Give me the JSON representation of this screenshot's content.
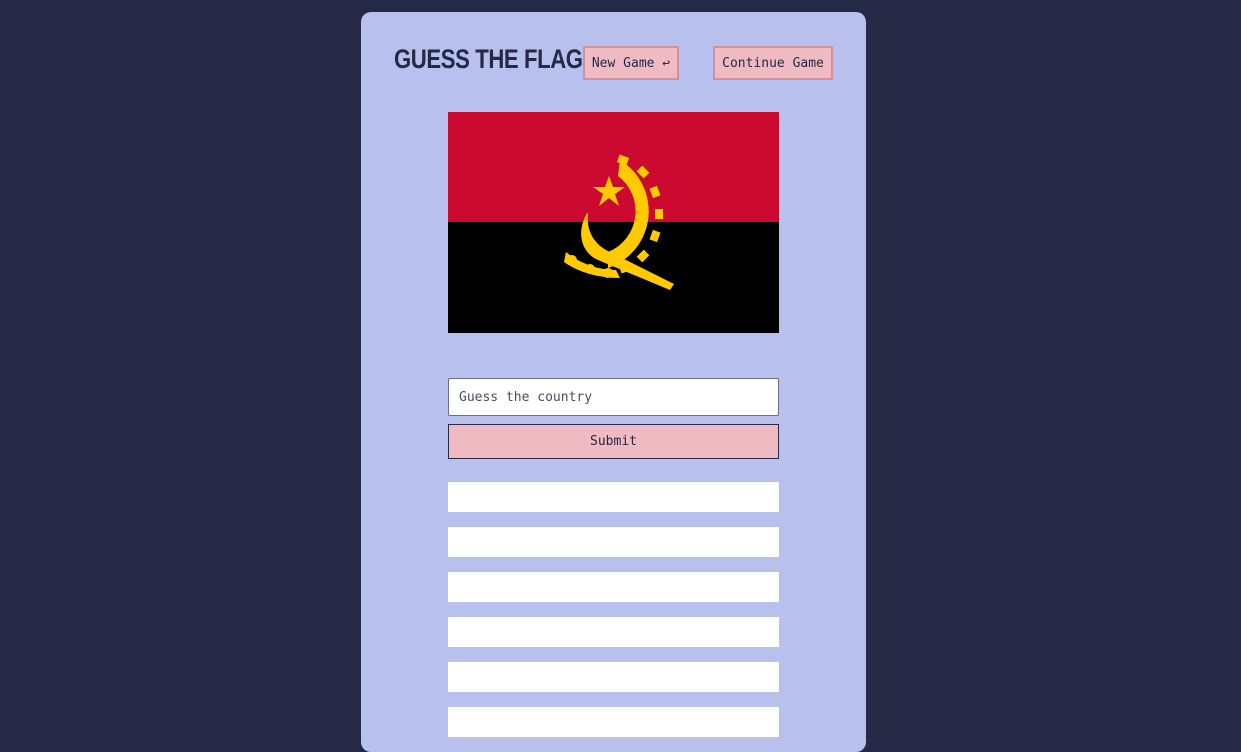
{
  "header": {
    "title": "Guess the Flag",
    "new_game_label": "New Game ↩",
    "continue_label": "Continue Game"
  },
  "flag": {
    "country": "Angola",
    "colors": {
      "top": "#cc092f",
      "bottom": "#000000",
      "emblem": "#ffcb00"
    }
  },
  "guess": {
    "placeholder": "Guess the country",
    "value": "",
    "submit_label": "Submit"
  },
  "guesses": [
    "",
    "",
    "",
    "",
    "",
    ""
  ]
}
